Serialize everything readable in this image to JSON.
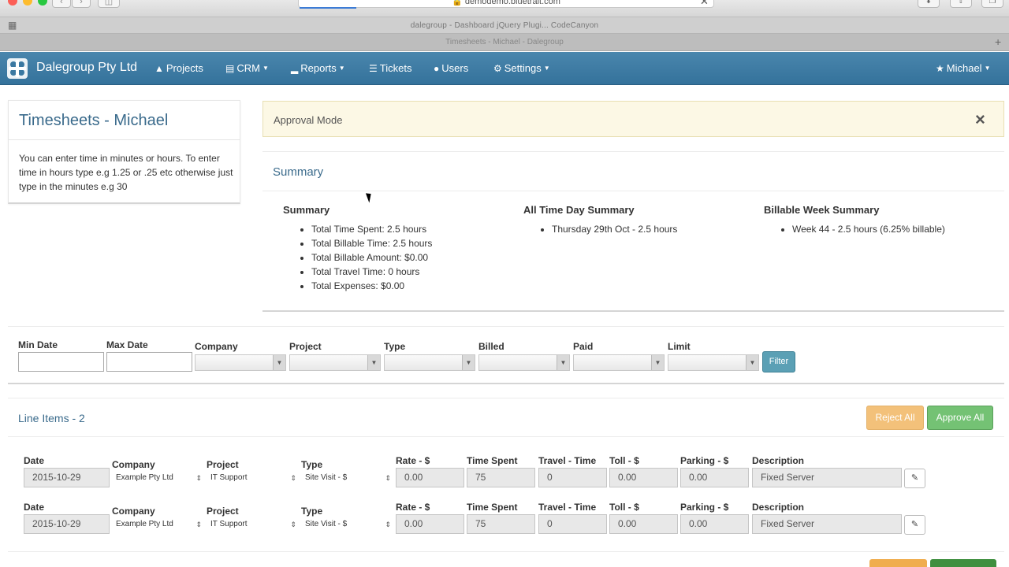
{
  "browser": {
    "url": "demodemo.bluetrait.com",
    "bookmarks_text": "dalegroup - Dashboard    jQuery Plugi... CodeCanyon",
    "tab_text": "Timesheets - Michael - Dalegroup"
  },
  "navbar": {
    "brand": "Dalegroup Pty Ltd",
    "items": [
      {
        "label": "Projects",
        "icon": "road-icon"
      },
      {
        "label": "CRM",
        "icon": "list-icon",
        "dropdown": true
      },
      {
        "label": "Reports",
        "icon": "bar-chart-icon",
        "dropdown": true
      },
      {
        "label": "Tickets",
        "icon": "list-icon"
      },
      {
        "label": "Users",
        "icon": "user-icon"
      },
      {
        "label": "Settings",
        "icon": "gear-icon",
        "dropdown": true
      }
    ],
    "user": "Michael"
  },
  "left_panel": {
    "title": "Timesheets - Michael",
    "help_text": "You can enter time in minutes or hours. To enter time in hours type e.g 1.25 or .25 etc otherwise just type in the minutes e.g 30"
  },
  "alert": {
    "text": "Approval Mode",
    "close": "×"
  },
  "summary": {
    "title": "Summary",
    "columns": [
      {
        "heading": "Summary",
        "items": [
          "Total Time Spent: 2.5 hours",
          "Total Billable Time: 2.5 hours",
          "Total Billable Amount: $0.00",
          "Total Travel Time: 0 hours",
          "Total Expenses: $0.00"
        ]
      },
      {
        "heading": "All Time Day Summary",
        "items": [
          "Thursday 29th Oct - 2.5 hours"
        ]
      },
      {
        "heading": "Billable Week Summary",
        "items": [
          "Week 44 - 2.5 hours (6.25% billable)"
        ]
      }
    ]
  },
  "filter": {
    "min_date": "Min Date",
    "max_date": "Max Date",
    "company": "Company",
    "project": "Project",
    "type": "Type",
    "billed": "Billed",
    "paid": "Paid",
    "limit": "Limit",
    "button": "Filter"
  },
  "line_items": {
    "title": "Line Items - 2",
    "reject_all": "Reject All",
    "approve_all": "Approve All",
    "labels": {
      "date": "Date",
      "company": "Company",
      "project": "Project",
      "type": "Type",
      "rate": "Rate - $",
      "time_spent": "Time Spent",
      "travel_time": "Travel - Time",
      "toll": "Toll - $",
      "parking": "Parking - $",
      "description": "Description"
    },
    "rows": [
      {
        "date": "2015-10-29",
        "company": "Example Pty Ltd",
        "project": "IT Support",
        "type": "Site Visit - $",
        "rate": "0.00",
        "time_spent": "75",
        "travel_time": "0",
        "toll": "0.00",
        "parking": "0.00",
        "description": "Fixed Server"
      },
      {
        "date": "2015-10-29",
        "company": "Example Pty Ltd",
        "project": "IT Support",
        "type": "Site Visit - $",
        "rate": "0.00",
        "time_spent": "75",
        "travel_time": "0",
        "toll": "0.00",
        "parking": "0.00",
        "description": "Fixed Server"
      }
    ]
  },
  "colors": {
    "navbar": "#3a78a1",
    "title_blue": "#3b6b8c",
    "alert_bg": "#fcf8e5",
    "reject": "#f0ad4e",
    "approve": "#5cb85c",
    "filter_btn": "#5ba0b5"
  }
}
